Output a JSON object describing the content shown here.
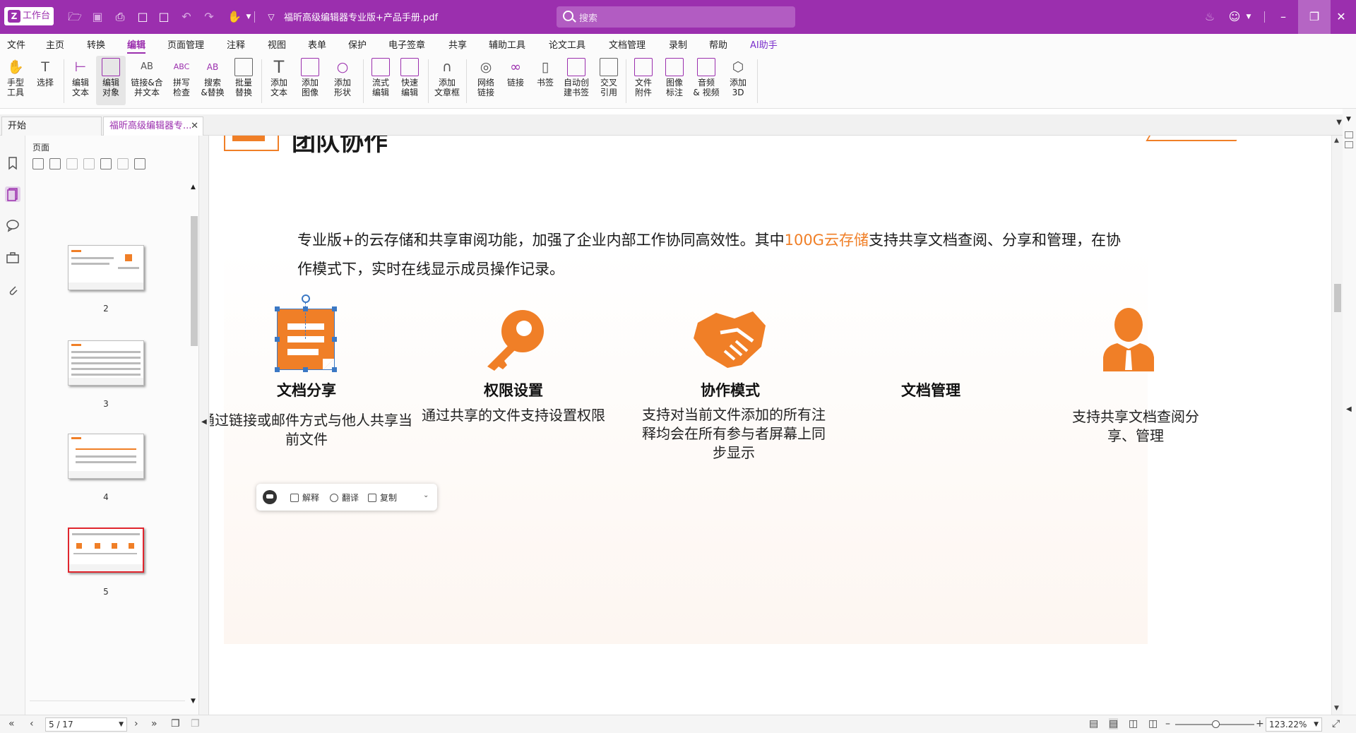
{
  "titlebar": {
    "workbench_label": "工作台",
    "filename": "福昕高级编辑器专业版+产品手册.pdf",
    "search_placeholder": "搜索"
  },
  "menu": [
    "文件",
    "主页",
    "转换",
    "编辑",
    "页面管理",
    "注释",
    "视图",
    "表单",
    "保护",
    "电子签章",
    "共享",
    "辅助工具",
    "论文工具",
    "文档管理",
    "录制",
    "帮助",
    "AI助手"
  ],
  "menu_active": "编辑",
  "ribbon": [
    {
      "label": "手型\n工具",
      "icon": "hand-icon"
    },
    {
      "label": "选择",
      "icon": "select-icon"
    },
    {
      "label": "编辑\n文本",
      "icon": "edit-text-icon"
    },
    {
      "label": "编辑\n对象",
      "icon": "edit-object-icon"
    },
    {
      "label": "链接&合\n并文本",
      "icon": "link-merge-icon"
    },
    {
      "label": "拼写\n检查",
      "icon": "spell-check-icon"
    },
    {
      "label": "搜索\n&替换",
      "icon": "search-replace-icon"
    },
    {
      "label": "批量\n替换",
      "icon": "batch-replace-icon"
    },
    {
      "label": "添加\n文本",
      "icon": "add-text-icon"
    },
    {
      "label": "添加\n图像",
      "icon": "add-image-icon"
    },
    {
      "label": "添加\n形状",
      "icon": "add-shape-icon"
    },
    {
      "label": "流式\n编辑",
      "icon": "flow-edit-icon"
    },
    {
      "label": "快速\n编辑",
      "icon": "quick-edit-icon"
    },
    {
      "label": "添加\n文章框",
      "icon": "article-box-icon"
    },
    {
      "label": "网络\n链接",
      "icon": "web-link-icon"
    },
    {
      "label": "链接",
      "icon": "link-icon"
    },
    {
      "label": "书签",
      "icon": "bookmark-icon"
    },
    {
      "label": "自动创\n建书签",
      "icon": "auto-bookmark-icon"
    },
    {
      "label": "交叉\n引用",
      "icon": "cross-ref-icon"
    },
    {
      "label": "文件\n附件",
      "icon": "file-attachment-icon"
    },
    {
      "label": "图像\n标注",
      "icon": "image-annotation-icon"
    },
    {
      "label": "音频\n& 视频",
      "icon": "audio-video-icon"
    },
    {
      "label": "添加\n3D",
      "icon": "add-3d-icon"
    }
  ],
  "tabs": [
    {
      "label": "开始"
    },
    {
      "label": "福昕高级编辑器专..."
    }
  ],
  "panel": {
    "title": "页面",
    "pages": [
      "2",
      "3",
      "4",
      "5"
    ],
    "selected_page": "5"
  },
  "document": {
    "heading": "团队协作",
    "intro_part1": "专业版+的云存储和共享审阅功能，加强了企业内部工作协同高效性。其中",
    "intro_highlight": "100G云存储",
    "intro_part2": "支持共享文档查阅、分享和管理，在协作模式下，实时在线显示成员操作记录。",
    "features": [
      {
        "title": "文档分享",
        "desc": "通过链接或邮件方式与他人共享当前文件",
        "icon": "document-share-icon"
      },
      {
        "title": "权限设置",
        "desc": "通过共享的文件支持设置权限",
        "icon": "key-icon"
      },
      {
        "title": "协作模式",
        "desc": "支持对当前文件添加的所有注释均会在所有参与者屏幕上同步显示",
        "icon": "handshake-icon"
      },
      {
        "title": "文档管理",
        "desc": "支持共享文档查阅分享、管理",
        "icon": "person-icon"
      }
    ],
    "accent_color": "#f07f27"
  },
  "float_toolbar": {
    "explain": "解释",
    "translate": "翻译",
    "copy": "复制"
  },
  "statusbar": {
    "page_value": "5 / 17",
    "zoom_value": "123.22%"
  },
  "colors": {
    "brand": "#9b2fae",
    "accent": "#f07f27",
    "selection": "#3b78c4"
  }
}
